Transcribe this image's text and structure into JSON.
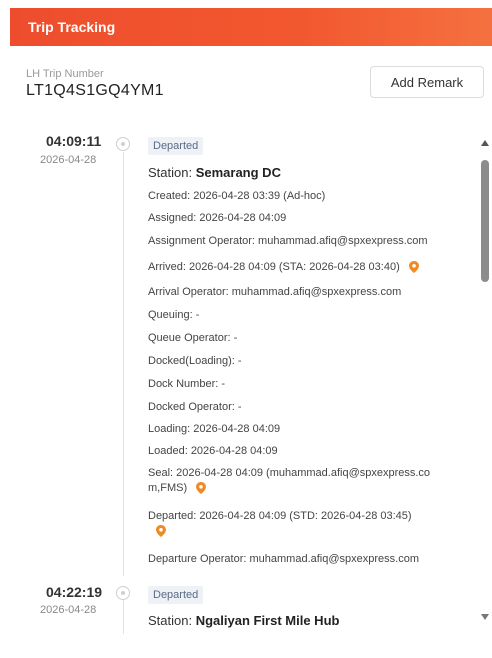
{
  "header": {
    "title": "Trip Tracking"
  },
  "trip": {
    "label": "LH Trip Number",
    "number": "LT1Q4S1GQ4YM1"
  },
  "actions": {
    "add_remark": "Add Remark"
  },
  "colors": {
    "brand": "#ee4d2d",
    "pin": "#f08a24",
    "badge_bg": "#eef1f6"
  },
  "entries": [
    {
      "time": "04:09:11",
      "date": "2026-04-28",
      "status": "Departed",
      "station_prefix": "Station: ",
      "station_name": "Semarang DC",
      "lines": [
        "Created: 2026-04-28 03:39 (Ad-hoc)",
        "Assigned: 2026-04-28 04:09",
        "Assignment Operator: muhammad.afiq@spxexpress.com",
        "Arrived: 2026-04-28 04:09 (STA: 2026-04-28 03:40)",
        "Arrival Operator: muhammad.afiq@spxexpress.com",
        "Queuing: -",
        "Queue Operator: -",
        "Docked(Loading): -",
        "Dock Number: -",
        "Docked Operator: -",
        "Loading: 2026-04-28 04:09",
        "Loaded: 2026-04-28 04:09",
        "Seal: 2026-04-28 04:09 (muhammad.afiq@spxexpress.co m,FMS)",
        "Departed: 2026-04-28 04:09 (STD: 2026-04-28 03:45)",
        "Departure Operator: muhammad.afiq@spxexpress.com"
      ]
    },
    {
      "time": "04:22:19",
      "date": "2026-04-28",
      "status": "Departed",
      "station_prefix": "Station: ",
      "station_name": "Ngaliyan First Mile Hub"
    }
  ],
  "icons": {
    "node": "timeline-node-icon",
    "pin": "location-pin-icon"
  }
}
